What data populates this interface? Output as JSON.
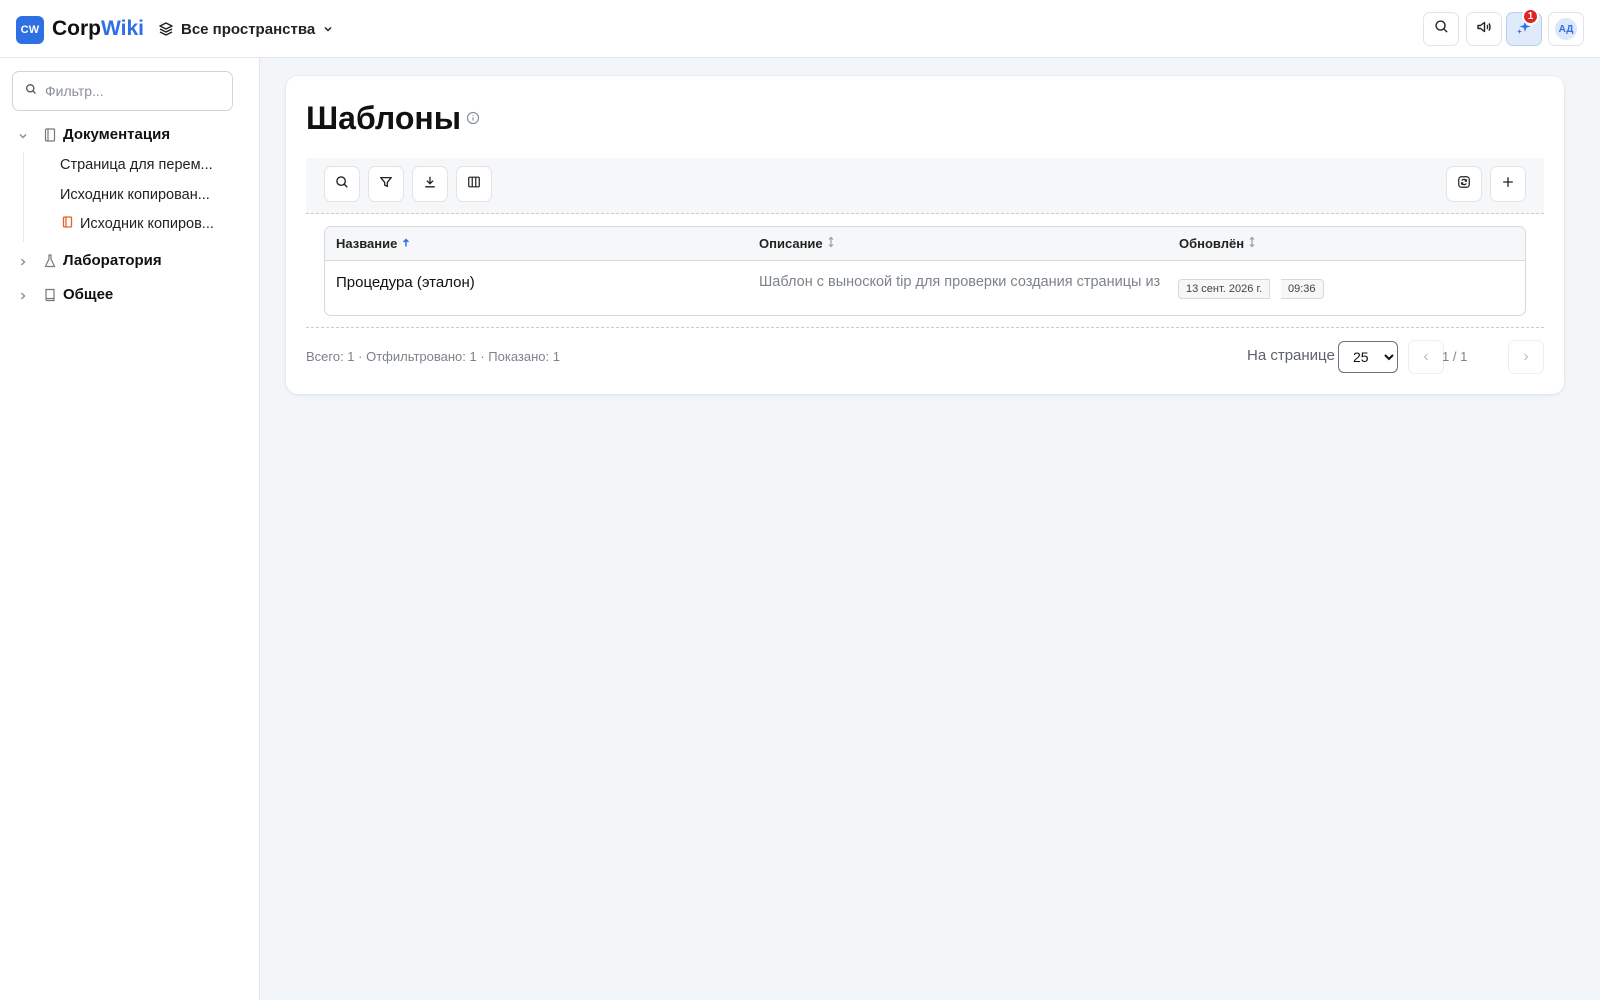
{
  "header": {
    "logo_badge": "CW",
    "logo_part1": "Corp",
    "logo_part2": "Wiki",
    "space_switcher_label": "Все пространства",
    "notifications_count": "1",
    "avatar_initials": "АД",
    "accent_color": "#2f6fe4"
  },
  "sidebar": {
    "filter_placeholder": "Фильтр...",
    "spaces": [
      {
        "label": "Документация",
        "icon": "book-icon",
        "expanded": true,
        "children": [
          {
            "label": "Страница для перем..."
          },
          {
            "label": "Исходник копирован..."
          },
          {
            "label": "Исходник копиров...",
            "icon": "book-icon"
          }
        ]
      },
      {
        "label": "Лаборатория",
        "icon": "flask-icon",
        "expanded": false
      },
      {
        "label": "Общее",
        "icon": "bookmark-icon",
        "expanded": false
      }
    ]
  },
  "main": {
    "title": "Шаблоны",
    "table": {
      "columns": [
        {
          "label": "Название",
          "sort": "asc"
        },
        {
          "label": "Описание",
          "sort": "none"
        },
        {
          "label": "Обновлён",
          "sort": "none"
        }
      ],
      "rows": [
        {
          "name": "Процедура (эталон)",
          "description": "Шаблон с выноской tip для проверки создания страницы из",
          "updated_date": "13 сент. 2026 г.",
          "updated_time": "09:36"
        }
      ]
    },
    "footer": {
      "summary": "Всего: 1 · Отфильтровано: 1 · Показано: 1",
      "per_page_label": "На странице",
      "per_page_value": "25",
      "per_page_options": [
        "25"
      ],
      "page_indicator": "1 / 1",
      "prev_label": "‹",
      "next_label": "›"
    }
  }
}
